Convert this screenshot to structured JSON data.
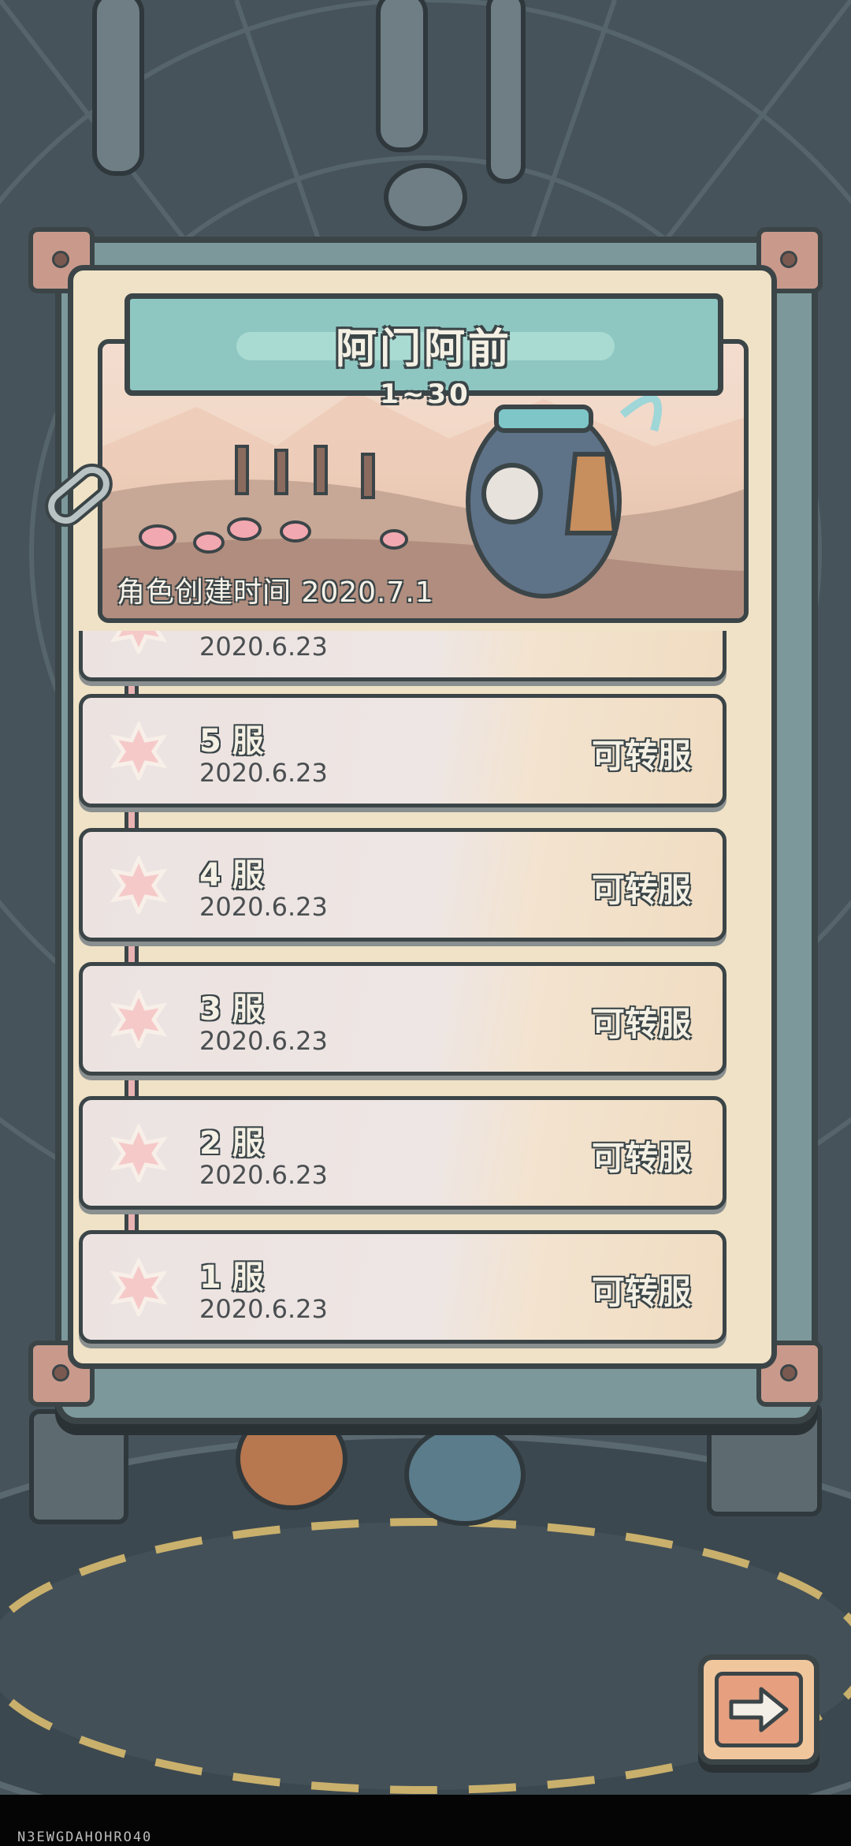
{
  "header": {
    "title": "阿门阿前",
    "level_range": "1~30",
    "creation_time": "角色创建时间 2020.7.1"
  },
  "servers": [
    {
      "name": "",
      "date": "2020.6.23",
      "action": "",
      "partial": true
    },
    {
      "name": "5 服",
      "date": "2020.6.23",
      "action": "可转服"
    },
    {
      "name": "4 服",
      "date": "2020.6.23",
      "action": "可转服"
    },
    {
      "name": "3 服",
      "date": "2020.6.23",
      "action": "可转服"
    },
    {
      "name": "2 服",
      "date": "2020.6.23",
      "action": "可转服"
    },
    {
      "name": "1 服",
      "date": "2020.6.23",
      "action": "可转服"
    }
  ],
  "footer": {
    "next_icon": "arrow-right-icon",
    "device_id": "N3EWGDAHOHRO40"
  },
  "colors": {
    "panel": "#7c989a",
    "panel_inner": "#efe2c6",
    "title_plate": "#8ec7c1",
    "timeline": "#eab3b3",
    "outline": "#3b4548",
    "button": "#f0c79d"
  }
}
